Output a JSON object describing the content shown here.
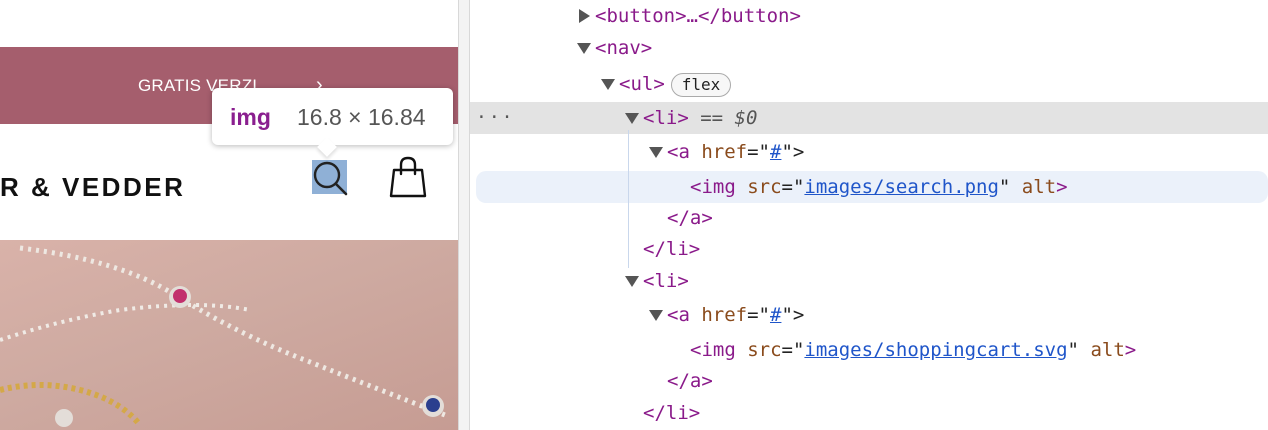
{
  "preview": {
    "promo_text": "GRATIS VERZI",
    "promo_arrow": "›",
    "brand": "R & VEDDER",
    "icons": {
      "search": "search-icon",
      "cart": "shopping-bag-icon"
    }
  },
  "tooltip": {
    "tag": "img",
    "size": "16.8 × 16.84"
  },
  "devtools": {
    "button_line": "<button>…</button>",
    "nav_open": "<nav>",
    "ul_open": "<ul>",
    "flex_badge": "flex",
    "li_open": "<li>",
    "selected_marker": " == ",
    "selected_var": "$0",
    "a_open_prefix": "<a ",
    "href_attr": "href",
    "eq_quote": "=\"",
    "href_value": "#",
    "close_quote_gt": "\">",
    "img_prefix": "<img ",
    "src_attr": "src",
    "search_src": "images/search.png",
    "cart_src": "images/shoppingcart.svg",
    "quote": "\"",
    "alt_attr": "alt",
    "gt": ">",
    "a_close": "</a>",
    "li_close": "</li>",
    "ellipsis": "···"
  },
  "colors": {
    "promo_bg": "#a55e6d",
    "tag": "#8a1a8a",
    "attr": "#8a4b1c",
    "link": "#1f55c9",
    "highlight": "#8fb0d6"
  }
}
